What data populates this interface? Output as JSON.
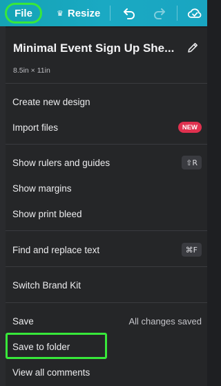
{
  "toolbar": {
    "file_label": "File",
    "resize_label": "Resize",
    "crown_icon": "crown-icon",
    "undo_icon": "undo-icon",
    "redo_icon": "redo-icon",
    "cloud_icon": "cloud-saved-icon",
    "accent": "#1aa9c3",
    "highlight": "#38e83a"
  },
  "menu": {
    "title": "Minimal Event Sign Up She...",
    "size": "8.5in × 11in",
    "edit_icon": "pencil-icon",
    "groups": [
      {
        "items": [
          {
            "label": "Create new design"
          },
          {
            "label": "Import files",
            "badge": "NEW"
          }
        ]
      },
      {
        "items": [
          {
            "label": "Show rulers and guides",
            "shortcut": "⇧R"
          },
          {
            "label": "Show margins"
          },
          {
            "label": "Show print bleed"
          }
        ]
      },
      {
        "items": [
          {
            "label": "Find and replace text",
            "shortcut": "⌘F"
          }
        ]
      },
      {
        "items": [
          {
            "label": "Switch Brand Kit"
          }
        ]
      },
      {
        "items": [
          {
            "label": "Save",
            "status": "All changes saved"
          },
          {
            "label": "Save to folder"
          },
          {
            "label": "View all comments"
          }
        ]
      }
    ]
  }
}
